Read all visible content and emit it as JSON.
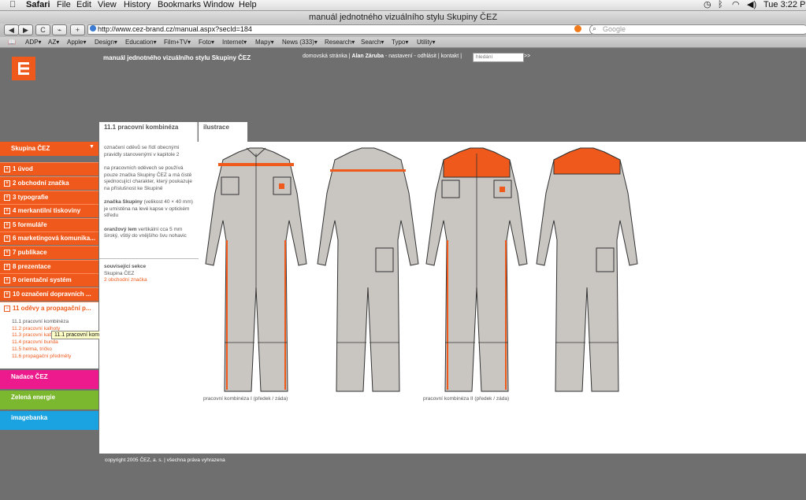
{
  "menubar": {
    "items": [
      "Safari",
      "File",
      "Edit",
      "View",
      "History",
      "Bookmarks",
      "Window",
      "Help"
    ],
    "clock": "Tue 3:22 PM"
  },
  "window": {
    "title": "manuál jednotného vizuálního stylu Skupiny ČEZ"
  },
  "toolbar": {
    "back": "◀",
    "forward": "▶",
    "reload": "C",
    "url": "http://www.cez-brand.cz/manual.aspx?secId=184",
    "search_placeholder": "Google"
  },
  "bookmarks": [
    "ADP▾",
    "AZ▾",
    "Apple▾",
    "Design▾",
    "Education▾",
    "Film+TV▾",
    "Foto▾",
    "Internet▾",
    "Mapy▾",
    "News (333)▾",
    "Research▾",
    "Search▾",
    "Typo▾",
    "Utility▾"
  ],
  "header": {
    "site_title": "manuál jednotného vizuálního stylu Skupiny ČEZ",
    "nav_home": "domovská stránka",
    "nav_user": "Alan Záruba",
    "nav_settings": "nastavení",
    "nav_logout": "odhlásit",
    "nav_contact": "kontakt",
    "search_placeholder": "hledání",
    "search_go": ">>"
  },
  "sidebar": {
    "group": "Skupina ČEZ",
    "items": [
      "1 úvod",
      "2 obchodní značka",
      "3 typografie",
      "4 merkantilní tiskoviny",
      "5 formuláře",
      "6 marketingová komunika...",
      "7 publikace",
      "8 prezentace",
      "9 orientační systém",
      "10 označení dopravních ...",
      "11 oděvy a propagační p..."
    ],
    "subitems": [
      "11.1 pracovní kombinéza",
      "11.2 pracovní kalhoty",
      "11.3 pracovní kabát",
      "11.4 pracovní bunda",
      "11.5 helma, tričko",
      "11.6 propagační předměty"
    ],
    "tooltip": "11.1 pracovní kombinéza",
    "brands": [
      "Nadace ČEZ",
      "Zelená energie",
      "imagebanka"
    ]
  },
  "tabs": [
    "11.1 pracovní kombinéza",
    "ilustrace"
  ],
  "text": {
    "p1": "označení oděvů se řídí obecnými pravidly stanovenými v kapitole 2",
    "p2": "na pracovních oděvech se používá pouze značka Skupiny ČEZ a má čistě sjednocující charakter, který poukazuje na příslušnost ke Skupině",
    "p3_bold": "značka Skupiny",
    "p3": " (velikost 40 × 40 mm) je umístěna na levé kapse v optickém středu",
    "p4_bold": "oranžový lem",
    "p4": " vertikální cca 5 mm široký, vštiý do vnějšího švu nohavic",
    "related_title": "související sekce",
    "related_1": "Skupina ČEZ",
    "related_2": "2 obchodní značka"
  },
  "captions": {
    "left": "pracovní kombinéza I (předek / záda)",
    "right": "pracovní kombinéza II (předek / záda)"
  },
  "footer": "copyright 2005 ČEZ, a. s. | všechna práva vyhrazena",
  "colors": {
    "orange": "#ef5a1c",
    "pink": "#ec1a8c",
    "green": "#7cb82f",
    "blue": "#1aa3e0",
    "garment": "#c9c6c2"
  }
}
